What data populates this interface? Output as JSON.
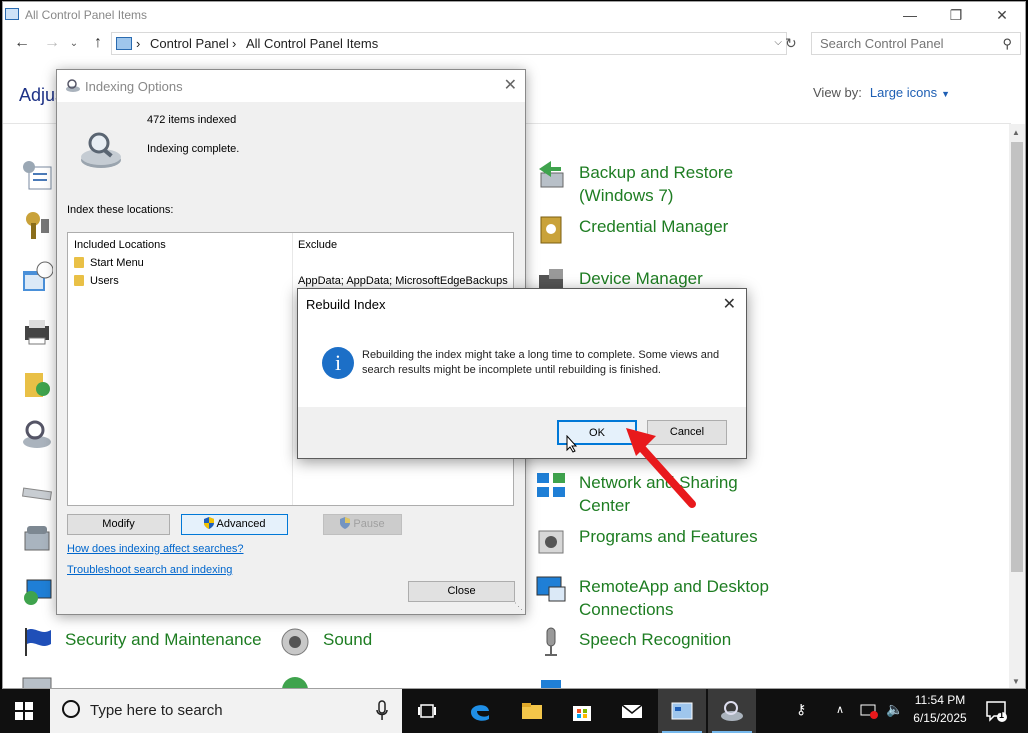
{
  "window": {
    "title": "All Control Panel Items",
    "minimize_icon": "minimize-icon",
    "maximize_icon": "restore-icon",
    "close_icon": "close-icon"
  },
  "nav": {
    "breadcrumb": [
      "Control Panel",
      "All Control Panel Items"
    ],
    "search_placeholder": "Search Control Panel"
  },
  "header": {
    "heading": "Adjus",
    "view_by_label": "View by:",
    "view_by_value": "Large icons"
  },
  "items_right": [
    {
      "label": "Backup and Restore\n(Windows 7)",
      "icon": "backup-restore-icon"
    },
    {
      "label": "Credential Manager",
      "icon": "credential-manager-icon"
    },
    {
      "label": "Device Manager",
      "icon": "device-manager-icon"
    },
    {
      "label": "Network and Sharing\nCenter",
      "icon": "network-sharing-icon"
    },
    {
      "label": "Programs and Features",
      "icon": "programs-features-icon"
    },
    {
      "label": "RemoteApp and Desktop\nConnections",
      "icon": "remoteapp-icon"
    },
    {
      "label": "Speech Recognition",
      "icon": "microphone-icon"
    }
  ],
  "items_bottom": [
    {
      "label": "Security and Maintenance",
      "icon": "flag-icon"
    },
    {
      "label": "Sound",
      "icon": "speaker-icon"
    }
  ],
  "indexing_dialog": {
    "title": "Indexing Options",
    "items_indexed": "472 items indexed",
    "status": "Indexing complete.",
    "locations_label": "Index these locations:",
    "col_included": "Included Locations",
    "col_exclude": "Exclude",
    "rows": [
      {
        "name": "Start Menu",
        "exclude": ""
      },
      {
        "name": "Users",
        "exclude": "AppData; AppData; MicrosoftEdgeBackups"
      }
    ],
    "btn_modify": "Modify",
    "btn_advanced": "Advanced",
    "btn_pause": "Pause",
    "link_affect": "How does indexing affect searches?",
    "link_trouble": "Troubleshoot search and indexing",
    "btn_close": "Close"
  },
  "rebuild_dialog": {
    "title": "Rebuild Index",
    "message": "Rebuilding the index might take a long time to complete. Some views and search results might be incomplete until rebuilding is finished.",
    "btn_ok": "OK",
    "btn_cancel": "Cancel"
  },
  "taskbar": {
    "search_placeholder": "Type here to search",
    "time": "11:54 PM",
    "date": "6/15/2025",
    "notification_count": "1",
    "apps": [
      "task-view-icon",
      "edge-icon",
      "file-explorer-icon",
      "store-icon",
      "mail-icon",
      "control-panel-icon",
      "indexing-options-icon"
    ]
  },
  "colors": {
    "link_green": "#1e7d22",
    "heading_blue": "#1e3287",
    "accent": "#0078d7",
    "annotation_arrow": "#e8191c"
  }
}
